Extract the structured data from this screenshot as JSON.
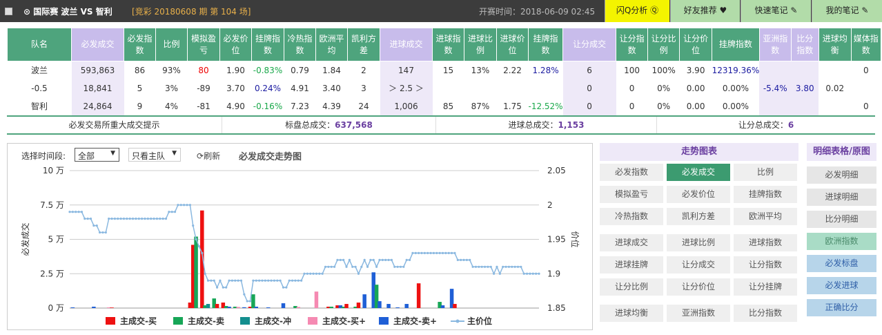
{
  "topbar": {
    "league": "⊙ 国际赛  波兰  VS 智利",
    "period": "[竞彩 20180608 期 第 104 场]",
    "start_time": "开赛时间：2018-06-09 02:45",
    "btn_q": "闪Q分析",
    "btn_friend": "好友推荐",
    "btn_note": "快速笔记",
    "btn_mynote": "我的笔记"
  },
  "table": {
    "headers": [
      "队名",
      "必发成交",
      "必发指数",
      "比例",
      "模拟盈亏",
      "必发价位",
      "挂牌指数",
      "冷热指数",
      "欧洲平均",
      "凯利方差",
      "进球成交",
      "进球指数",
      "进球比例",
      "进球价位",
      "挂牌指数",
      "让分成交",
      "让分指数",
      "让分比例",
      "让分价位",
      "挂牌指数",
      "亚洲指数",
      "比分指数",
      "进球均衡",
      "媒体指数"
    ],
    "rows": [
      [
        "波兰",
        "593,863",
        "86",
        "93%",
        "80",
        "1.90",
        "-0.83%",
        "0.79",
        "1.84",
        "2",
        "147",
        "15",
        "13%",
        "2.22",
        "1.28%",
        "6",
        "100",
        "100%",
        "3.90",
        "12319.36%",
        "",
        "",
        "",
        "0"
      ],
      [
        "-0.5",
        "18,841",
        "5",
        "3%",
        "-89",
        "3.70",
        "0.24%",
        "4.91",
        "3.40",
        "3",
        "＞ 2.5 ＞",
        "",
        "",
        "",
        "",
        "0",
        "0",
        "0%",
        "0.00",
        "0.00%",
        "-5.4%",
        "3.80",
        "0.02",
        ""
      ],
      [
        "智利",
        "24,864",
        "9",
        "4%",
        "-81",
        "4.90",
        "-0.16%",
        "7.23",
        "4.39",
        "24",
        "1,006",
        "85",
        "87%",
        "1.75",
        "-12.52%",
        "0",
        "0",
        "0%",
        "0.00",
        "0.00%",
        "",
        "",
        "",
        "0"
      ]
    ]
  },
  "summary": {
    "big": "必发交易所重大成交提示",
    "total_label": "标盘总成交：",
    "total_value": "637,568",
    "goal_label": "进球总成交：",
    "goal_value": "1,153",
    "handicap_label": "让分总成交：",
    "handicap_value": "6"
  },
  "controls": {
    "time_label": "选择时间段:",
    "time_value": "全部",
    "team_value": "只看主队",
    "refresh": "刷新",
    "chart_title": "必发成交走势图"
  },
  "chart_data": {
    "type": "bar",
    "title": "必发成交走势图",
    "ylabel": "必发成交",
    "y2label": "价位",
    "ylim": [
      0,
      100000
    ],
    "y2lim": [
      1.85,
      2.05
    ],
    "yticks": [
      "0 万",
      "2.5 万",
      "5 万",
      "7.5 万",
      "10 万"
    ],
    "y2ticks": [
      "1.85",
      "1.9",
      "1.95",
      "2",
      "2.05"
    ],
    "legend": [
      "主成交-买",
      "主成交-卖",
      "主成交-冲",
      "主成交-买+",
      "主成交-卖+",
      "主价位"
    ],
    "colors": [
      "#ee1111",
      "#17a657",
      "#148f8f",
      "#f58ab2",
      "#1f5fd6",
      "#8ab8e0"
    ],
    "bars": [
      {
        "i": 1,
        "s": 4,
        "v": 500
      },
      {
        "i": 8,
        "s": 4,
        "v": 1000
      },
      {
        "i": 13,
        "s": 3,
        "v": 500
      },
      {
        "i": 14,
        "s": 0,
        "v": 400
      },
      {
        "i": 40,
        "s": 0,
        "v": 4000
      },
      {
        "i": 41,
        "s": 0,
        "v": 46000
      },
      {
        "i": 42,
        "s": 1,
        "v": 52000
      },
      {
        "i": 44,
        "s": 0,
        "v": 71000
      },
      {
        "i": 45,
        "s": 1,
        "v": 2000
      },
      {
        "i": 46,
        "s": 2,
        "v": 3000
      },
      {
        "i": 48,
        "s": 1,
        "v": 7000
      },
      {
        "i": 49,
        "s": 0,
        "v": 3000
      },
      {
        "i": 51,
        "s": 0,
        "v": 4000
      },
      {
        "i": 52,
        "s": 1,
        "v": 1500
      },
      {
        "i": 53,
        "s": 4,
        "v": 1000
      },
      {
        "i": 55,
        "s": 1,
        "v": 1000
      },
      {
        "i": 56,
        "s": 3,
        "v": 800
      },
      {
        "i": 58,
        "s": 4,
        "v": 600
      },
      {
        "i": 60,
        "s": 0,
        "v": 1000
      },
      {
        "i": 61,
        "s": 1,
        "v": 10000
      },
      {
        "i": 62,
        "s": 4,
        "v": 1000
      },
      {
        "i": 66,
        "s": 4,
        "v": 500
      },
      {
        "i": 71,
        "s": 4,
        "v": 3500
      },
      {
        "i": 75,
        "s": 1,
        "v": 1500
      },
      {
        "i": 76,
        "s": 3,
        "v": 800
      },
      {
        "i": 82,
        "s": 3,
        "v": 12000
      },
      {
        "i": 86,
        "s": 0,
        "v": 1000
      },
      {
        "i": 87,
        "s": 1,
        "v": 1000
      },
      {
        "i": 89,
        "s": 0,
        "v": 2000
      },
      {
        "i": 90,
        "s": 4,
        "v": 2000
      },
      {
        "i": 91,
        "s": 1,
        "v": 1000
      },
      {
        "i": 92,
        "s": 0,
        "v": 3000
      },
      {
        "i": 95,
        "s": 1,
        "v": 1000
      },
      {
        "i": 96,
        "s": 0,
        "v": 4000
      },
      {
        "i": 98,
        "s": 4,
        "v": 10000
      },
      {
        "i": 101,
        "s": 4,
        "v": 26000
      },
      {
        "i": 102,
        "s": 1,
        "v": 17000
      },
      {
        "i": 103,
        "s": 4,
        "v": 5000
      },
      {
        "i": 106,
        "s": 4,
        "v": 3000
      },
      {
        "i": 109,
        "s": 4,
        "v": 500
      },
      {
        "i": 112,
        "s": 4,
        "v": 3000
      },
      {
        "i": 116,
        "s": 0,
        "v": 18000
      },
      {
        "i": 123,
        "s": 1,
        "v": 4500
      },
      {
        "i": 124,
        "s": 4,
        "v": 2000
      },
      {
        "i": 127,
        "s": 4,
        "v": 14000
      },
      {
        "i": 128,
        "s": 0,
        "v": 3000
      }
    ],
    "price": [
      1.99,
      1.99,
      1.99,
      1.99,
      1.99,
      1.98,
      1.98,
      1.98,
      1.97,
      1.97,
      1.96,
      1.96,
      1.96,
      1.98,
      1.98,
      1.98,
      1.98,
      1.98,
      1.98,
      1.98,
      1.98,
      1.98,
      1.98,
      1.98,
      1.98,
      1.98,
      1.98,
      1.98,
      1.98,
      1.98,
      1.98,
      1.98,
      1.98,
      1.99,
      1.99,
      1.99,
      2.0,
      2.0,
      2.0,
      2.0,
      2.0,
      1.97,
      1.95,
      1.94,
      1.93,
      1.9,
      1.89,
      1.89,
      1.89,
      1.88,
      1.89,
      1.88,
      1.88,
      1.89,
      1.89,
      1.89,
      1.89,
      1.89,
      1.87,
      1.86,
      1.86,
      1.89,
      1.89,
      1.89,
      1.89,
      1.89,
      1.89,
      1.89,
      1.89,
      1.89,
      1.89,
      1.88,
      1.88,
      1.89,
      1.89,
      1.89,
      1.89,
      1.89,
      1.9,
      1.9,
      1.9,
      1.9,
      1.9,
      1.9,
      1.9,
      1.91,
      1.91,
      1.91,
      1.91,
      1.92,
      1.92,
      1.92,
      1.91,
      1.92,
      1.91,
      1.91,
      1.9,
      1.91,
      1.92,
      1.91,
      1.92,
      1.92,
      1.91,
      1.92,
      1.92,
      1.92,
      1.92,
      1.92,
      1.91,
      1.91,
      1.91,
      1.91,
      1.92,
      1.92,
      1.93,
      1.93,
      1.93,
      1.93,
      1.93,
      1.93,
      1.93,
      1.93,
      1.93,
      1.93,
      1.93,
      1.93,
      1.93,
      1.93,
      1.93,
      1.92,
      1.92,
      1.92,
      1.92,
      1.92,
      1.91,
      1.91,
      1.91,
      1.91,
      1.91,
      1.91,
      1.91,
      1.9,
      1.91,
      1.9,
      1.91,
      1.91,
      1.91,
      1.91,
      1.91,
      1.91,
      1.91,
      1.9,
      1.9,
      1.9,
      1.9,
      1.9,
      1.9
    ]
  },
  "right_panel": {
    "title": "走势图表",
    "buttons": [
      "必发指数",
      "必发成交",
      "比例",
      "模拟盈亏",
      "必发价位",
      "挂牌指数",
      "冷热指数",
      "凯利方差",
      "欧洲平均",
      "进球成交",
      "进球比例",
      "进球指数",
      "进球挂牌",
      "让分成交",
      "让分指数",
      "让分比例",
      "让分价位",
      "让分挂牌",
      "进球均衡",
      "亚洲指数",
      "比分指数"
    ]
  },
  "far_panel": {
    "title": "明细表格/原图",
    "buttons": [
      "必发明细",
      "进球明细",
      "比分明细",
      "欧洲指数",
      "必发标盘",
      "必发进球",
      "正确比分"
    ]
  }
}
